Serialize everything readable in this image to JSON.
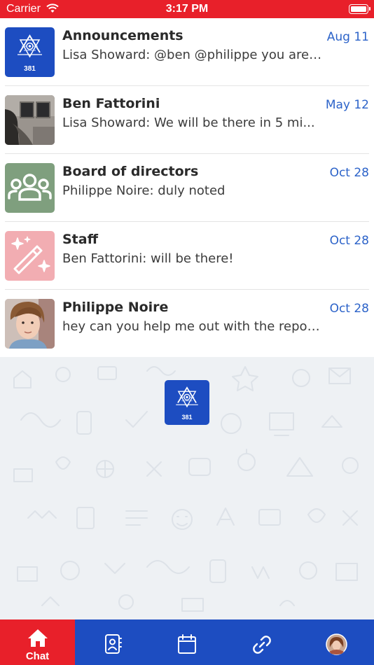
{
  "status_bar": {
    "carrier": "Carrier",
    "time": "3:17 PM"
  },
  "chats": [
    {
      "title": "Announcements",
      "preview": "Lisa Showard: @ben @philippe you are g...",
      "date": "Aug 11",
      "avatar": "lodge-logo-icon",
      "avatar_badge": "381"
    },
    {
      "title": "Ben Fattorini",
      "preview": "Lisa Showard: We will be there in 5 mi...",
      "date": "May 12",
      "avatar": "photo-avatar"
    },
    {
      "title": "Board of directors",
      "preview": "Philippe Noire: duly noted",
      "date": "Oct 28",
      "avatar": "group-icon",
      "avatar_color": "#7f9f7e"
    },
    {
      "title": "Staff",
      "preview": "Ben Fattorini: will be there!",
      "date": "Oct 28",
      "avatar": "magic-wand-icon",
      "avatar_color": "#f2adb2"
    },
    {
      "title": "Philippe Noire",
      "preview": "hey can you help me out with the report?",
      "date": "Oct 28",
      "avatar": "photo-avatar"
    }
  ],
  "wallpaper": {
    "logo_badge": "381"
  },
  "tab_bar": {
    "tabs": [
      {
        "label": "Chat",
        "icon": "home-icon",
        "active": true
      },
      {
        "label": "",
        "icon": "contacts-icon",
        "active": false
      },
      {
        "label": "",
        "icon": "calendar-icon",
        "active": false
      },
      {
        "label": "",
        "icon": "link-icon",
        "active": false
      },
      {
        "label": "",
        "icon": "profile-avatar",
        "active": false
      }
    ]
  },
  "colors": {
    "status_bar": "#e8202a",
    "tab_bar": "#1d4dc1",
    "tab_active": "#e8202a",
    "date_text": "#2c63c9",
    "logo_blue": "#1d4dc1"
  }
}
